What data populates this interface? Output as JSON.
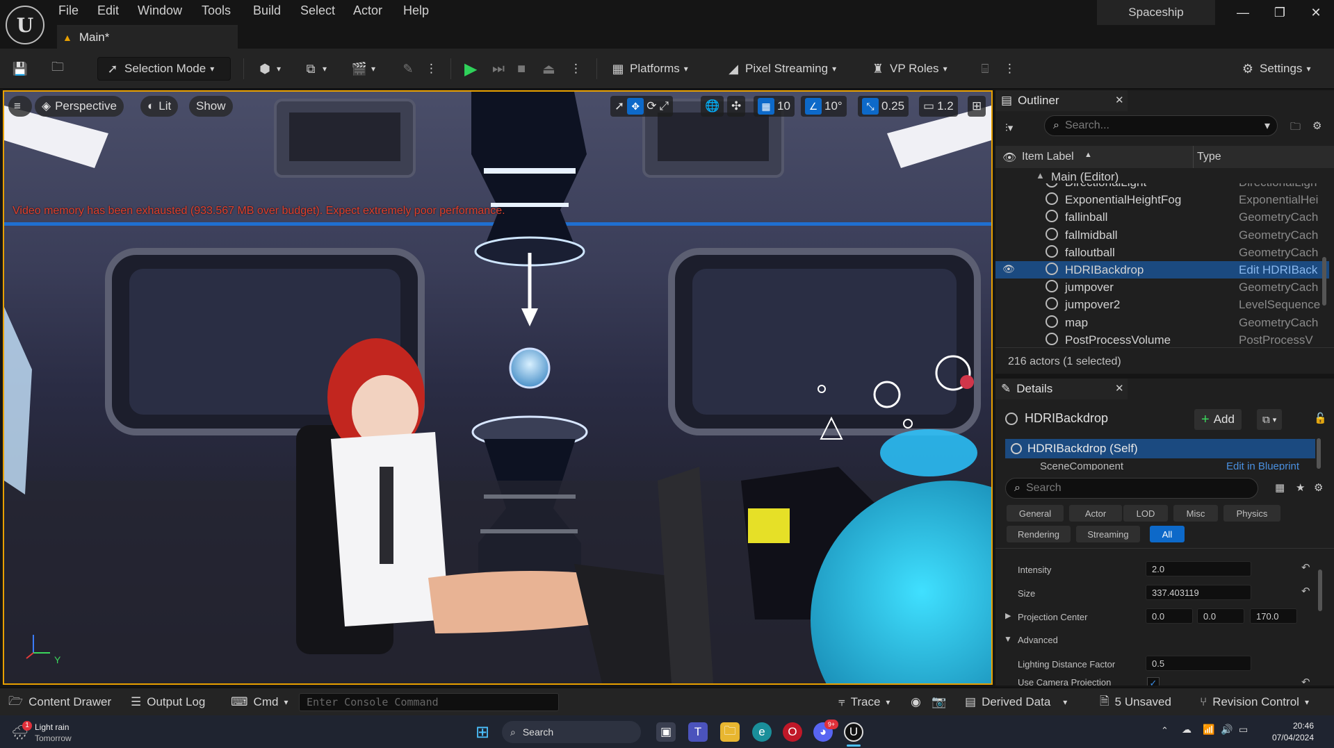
{
  "titlebar": {
    "menu": [
      "File",
      "Edit",
      "Window",
      "Tools",
      "Build",
      "Select",
      "Actor",
      "Help"
    ],
    "tab": "Main*",
    "project": "Spaceship",
    "window_buttons": [
      "—",
      "❐",
      "✕"
    ]
  },
  "toolbar": {
    "selection_mode": "Selection Mode",
    "platforms": "Platforms",
    "pixel_streaming": "Pixel Streaming",
    "vp_roles": "VP Roles",
    "settings": "Settings"
  },
  "viewport": {
    "perspective": "Perspective",
    "lit": "Lit",
    "show": "Show",
    "grid_snap": "10",
    "rotation_snap": "10°",
    "scale_snap": "0.25",
    "camera_speed": "1.2",
    "warning": "Video memory has been exhausted (933.567 MB over budget). Expect extremely poor performance.",
    "axis_y": "Y"
  },
  "outliner": {
    "title": "Outliner",
    "search_placeholder": "Search...",
    "col_label": "Item Label",
    "col_type": "Type",
    "root": "Main (Editor)",
    "rows": [
      {
        "label": "DirectionalLight",
        "type": "DirectionalLigh"
      },
      {
        "label": "ExponentialHeightFog",
        "type": "ExponentialHei"
      },
      {
        "label": "fallinball",
        "type": "GeometryCach"
      },
      {
        "label": "fallmidball",
        "type": "GeometryCach"
      },
      {
        "label": "falloutball",
        "type": "GeometryCach"
      },
      {
        "label": "HDRIBackdrop",
        "type": "Edit HDRIBack"
      },
      {
        "label": "jumpover",
        "type": "GeometryCach"
      },
      {
        "label": "jumpover2",
        "type": "LevelSequence"
      },
      {
        "label": "map",
        "type": "GeometryCach"
      },
      {
        "label": "PostProcessVolume",
        "type": "PostProcessV"
      }
    ],
    "status": "216 actors (1 selected)"
  },
  "details": {
    "title": "Details",
    "actor": "HDRIBackdrop",
    "add": "Add",
    "self_row": "HDRIBackdrop (Self)",
    "component": "SceneComponent",
    "component_link": "Edit in Blueprint",
    "search_placeholder": "Search",
    "categories_row1": [
      "General",
      "Actor",
      "LOD",
      "Misc",
      "Physics"
    ],
    "categories_row2": [
      "Rendering",
      "Streaming",
      "All"
    ],
    "props": {
      "intensity_label": "Intensity",
      "intensity": "2.0",
      "size_label": "Size",
      "size": "337.403119",
      "proj_label": "Projection Center",
      "proj_x": "0.0",
      "proj_y": "0.0",
      "proj_z": "170.0",
      "advanced": "Advanced",
      "ldf_label": "Lighting Distance Factor",
      "ldf": "0.5",
      "ucp_label": "Use Camera Projection"
    }
  },
  "bottombar": {
    "content_drawer": "Content Drawer",
    "output_log": "Output Log",
    "cmd": "Cmd",
    "console_placeholder": "Enter Console Command",
    "trace": "Trace",
    "derived_data": "Derived Data",
    "unsaved": "5 Unsaved",
    "revision_control": "Revision Control"
  },
  "taskbar": {
    "weather_title": "Light rain",
    "weather_sub": "Tomorrow",
    "weather_badge": "1",
    "search": "Search",
    "time": "20:46",
    "date": "07/04/2024",
    "discord_badge": "9+"
  },
  "colors": {
    "accent_blue": "#0d69c9",
    "viewport_border": "#e8a000",
    "warning_red": "#e0402d",
    "play_green": "#2fd15a"
  }
}
